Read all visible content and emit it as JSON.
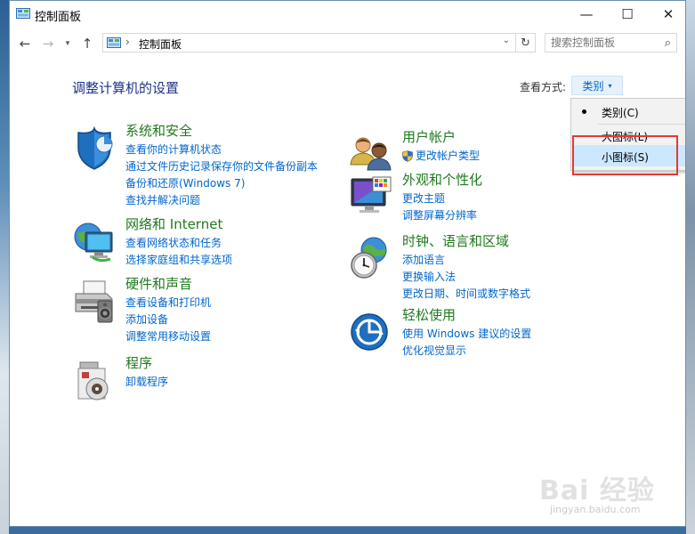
{
  "window": {
    "title": "控制面板",
    "controls": {
      "minimize": "—",
      "maximize": "☐",
      "close": "✕"
    }
  },
  "nav": {
    "back": "←",
    "forward": "→",
    "recent": "▾",
    "up": "↑",
    "address_sep": "›",
    "address": "控制面板",
    "address_dropdown": "⌄",
    "refresh": "↻",
    "search_placeholder": "搜索控制面板",
    "search_icon": "⌕"
  },
  "main": {
    "heading": "调整计算机的设置",
    "view_by_label": "查看方式:",
    "view_by_value": "类别",
    "view_by_arrow": "▾"
  },
  "view_menu": {
    "items": [
      {
        "label": "类别(C)",
        "selected": true
      },
      {
        "label": "大图标(L)",
        "selected": false
      },
      {
        "label": "小图标(S)",
        "selected": false
      }
    ]
  },
  "categories": {
    "system": {
      "title": "系统和安全",
      "links": [
        "查看你的计算机状态",
        "通过文件历史记录保存你的文件备份副本",
        "备份和还原(Windows 7)",
        "查找并解决问题"
      ]
    },
    "network": {
      "title": "网络和 Internet",
      "links": [
        "查看网络状态和任务",
        "选择家庭组和共享选项"
      ]
    },
    "hardware": {
      "title": "硬件和声音",
      "links": [
        "查看设备和打印机",
        "添加设备",
        "调整常用移动设置"
      ]
    },
    "programs": {
      "title": "程序",
      "links": [
        "卸载程序"
      ]
    },
    "accounts": {
      "title": "用户帐户",
      "links": [
        "更改帐户类型"
      ]
    },
    "appearance": {
      "title": "外观和个性化",
      "links": [
        "更改主题",
        "调整屏幕分辨率"
      ]
    },
    "clock": {
      "title": "时钟、语言和区域",
      "links": [
        "添加语言",
        "更换输入法",
        "更改日期、时间或数字格式"
      ]
    },
    "ease": {
      "title": "轻松使用",
      "links": [
        "使用 Windows 建议的设置",
        "优化视觉显示"
      ]
    }
  },
  "watermark": {
    "text": "Bai 经验",
    "sub": "jingyan.baidu.com"
  }
}
